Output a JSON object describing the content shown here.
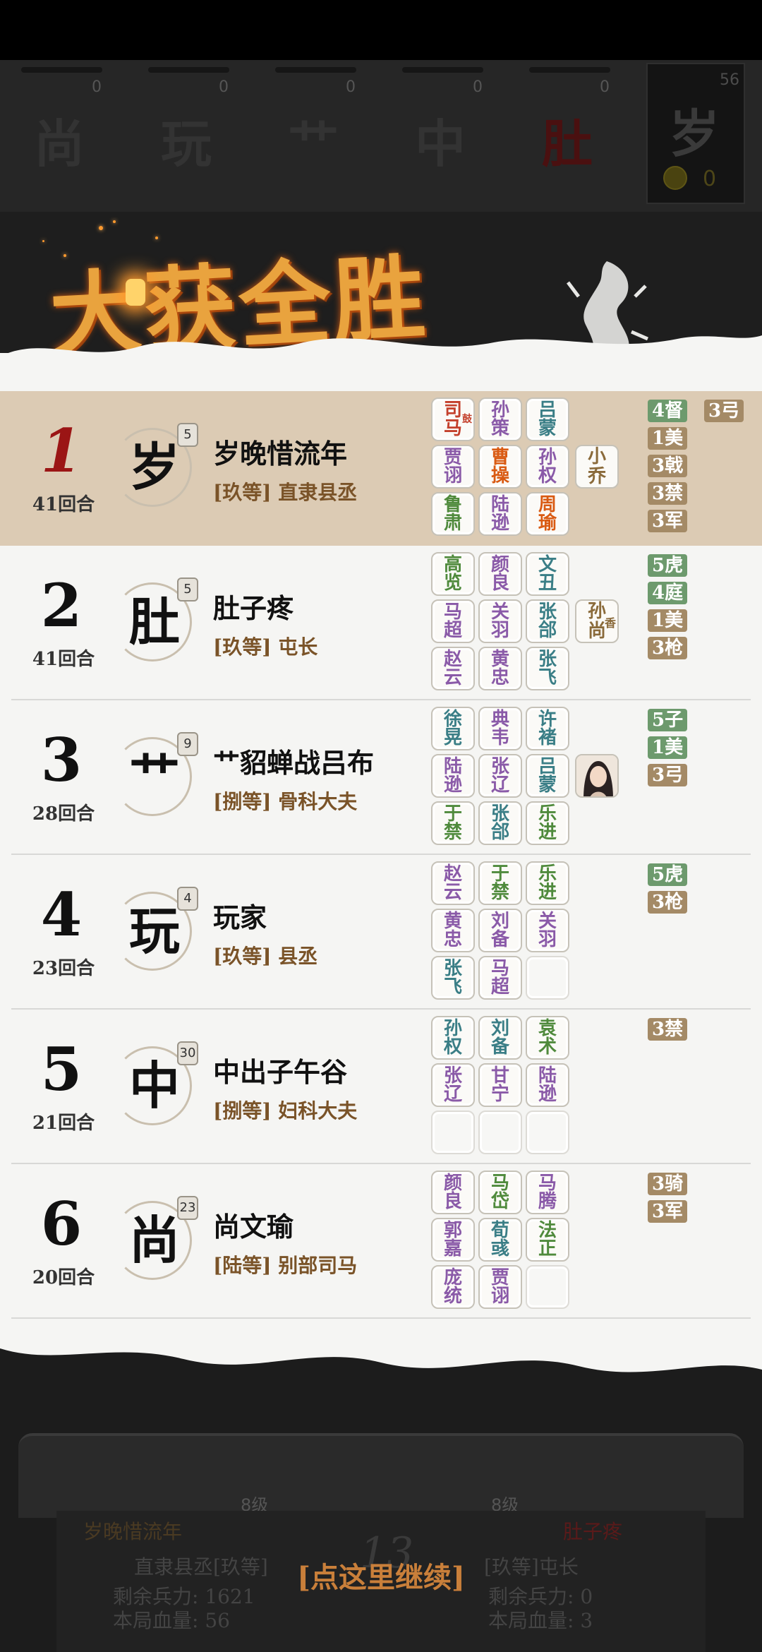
{
  "players_bar": [
    {
      "char": "尚",
      "count": "0"
    },
    {
      "char": "玩",
      "count": "0"
    },
    {
      "char": "艹",
      "count": "0"
    },
    {
      "char": "中",
      "count": "0"
    },
    {
      "char": "肚",
      "count": "0"
    }
  ],
  "players_bar_active": {
    "char": "岁",
    "count": "56",
    "coins": "0"
  },
  "banner": {
    "title": "大获全胜"
  },
  "rows": [
    {
      "rank": "1",
      "rounds": "41回合",
      "avatar_char": "岁",
      "level": "5",
      "name": "岁晚惜流年",
      "title": "[玖等] 直隶县丞",
      "heroes": [
        [
          "司",
          "马"
        ],
        [
          "孙",
          "策"
        ],
        [
          "吕",
          "蒙"
        ],
        [
          "贾",
          "诩"
        ],
        [
          "曹",
          "操"
        ],
        [
          "孙",
          "权"
        ],
        [
          "鲁",
          "肃"
        ],
        [
          "陆",
          "逊"
        ],
        [
          "周",
          "瑜"
        ]
      ],
      "hero_colors": [
        "c-red",
        "c-purple",
        "c-teal",
        "c-purple",
        "c-orange",
        "c-purple",
        "c-green",
        "c-purple",
        "c-orange"
      ],
      "hero_badge": "鼓",
      "extra": [
        "小",
        "乔"
      ],
      "tags": [
        "4督",
        "3弓",
        "1美",
        "3戟",
        "3禁",
        "3军"
      ]
    },
    {
      "rank": "2",
      "rounds": "41回合",
      "avatar_char": "肚",
      "level": "5",
      "name": "肚子疼",
      "title": "[玖等] 屯长",
      "heroes": [
        [
          "高",
          "览"
        ],
        [
          "颜",
          "良"
        ],
        [
          "文",
          "丑"
        ],
        [
          "马",
          "超"
        ],
        [
          "关",
          "羽"
        ],
        [
          "张",
          "郃"
        ],
        [
          "赵",
          "云"
        ],
        [
          "黄",
          "忠"
        ],
        [
          "张",
          "飞"
        ]
      ],
      "hero_colors": [
        "c-green",
        "c-purple",
        "c-teal",
        "c-purple",
        "c-purple",
        "c-teal",
        "c-purple",
        "c-purple",
        "c-teal"
      ],
      "extra": [
        "孙",
        "尚"
      ],
      "extra_badge": "香",
      "tags": [
        "5虎",
        "4庭",
        "1美",
        "3枪"
      ]
    },
    {
      "rank": "3",
      "rounds": "28回合",
      "avatar_char": "艹",
      "level": "9",
      "name": "艹貂蝉战吕布",
      "title": "[捌等] 骨科大夫",
      "heroes": [
        [
          "徐",
          "晃"
        ],
        [
          "典",
          "韦"
        ],
        [
          "许",
          "褚"
        ],
        [
          "陆",
          "逊"
        ],
        [
          "张",
          "辽"
        ],
        [
          "吕",
          "蒙"
        ],
        [
          "于",
          "禁"
        ],
        [
          "张",
          "郃"
        ],
        [
          "乐",
          "进"
        ]
      ],
      "hero_colors": [
        "c-teal",
        "c-purple",
        "c-teal",
        "c-purple",
        "c-purple",
        "c-teal",
        "c-green",
        "c-teal",
        "c-green"
      ],
      "tags": [
        "5子",
        "1美",
        "3弓"
      ]
    },
    {
      "rank": "4",
      "rounds": "23回合",
      "avatar_char": "玩",
      "level": "4",
      "name": "玩家",
      "title": "[玖等] 县丞",
      "heroes": [
        [
          "赵",
          "云"
        ],
        [
          "于",
          "禁"
        ],
        [
          "乐",
          "进"
        ],
        [
          "黄",
          "忠"
        ],
        [
          "刘",
          "备"
        ],
        [
          "关",
          "羽"
        ],
        [
          "张",
          "飞"
        ],
        [
          "马",
          "超"
        ],
        [
          "",
          ""
        ]
      ],
      "hero_colors": [
        "c-purple",
        "c-green",
        "c-green",
        "c-purple",
        "c-purple",
        "c-purple",
        "c-teal",
        "c-purple",
        ""
      ],
      "tags": [
        "5虎",
        "3枪"
      ]
    },
    {
      "rank": "5",
      "rounds": "21回合",
      "avatar_char": "中",
      "level": "30",
      "name": "中出子午谷",
      "title": "[捌等] 妇科大夫",
      "heroes": [
        [
          "孙",
          "权"
        ],
        [
          "刘",
          "备"
        ],
        [
          "袁",
          "术"
        ],
        [
          "张",
          "辽"
        ],
        [
          "甘",
          "宁"
        ],
        [
          "陆",
          "逊"
        ],
        [
          "",
          ""
        ],
        [
          "",
          ""
        ],
        [
          "",
          ""
        ]
      ],
      "hero_colors": [
        "c-teal",
        "c-teal",
        "c-green",
        "c-purple",
        "c-purple",
        "c-purple",
        "",
        "",
        ""
      ],
      "tags": [
        "3禁"
      ]
    },
    {
      "rank": "6",
      "rounds": "20回合",
      "avatar_char": "尚",
      "level": "23",
      "name": "尚文瑜",
      "title": "[陆等] 别部司马",
      "heroes": [
        [
          "颜",
          "良"
        ],
        [
          "马",
          "岱"
        ],
        [
          "马",
          "腾"
        ],
        [
          "郭",
          "嘉"
        ],
        [
          "荀",
          "彧"
        ],
        [
          "法",
          "正"
        ],
        [
          "庞",
          "统"
        ],
        [
          "贾",
          "诩"
        ],
        [
          "",
          ""
        ]
      ],
      "hero_colors": [
        "c-purple",
        "c-green",
        "c-purple",
        "c-purple",
        "c-teal",
        "c-green",
        "c-purple",
        "c-purple",
        ""
      ],
      "tags": [
        "3骑",
        "3军"
      ]
    }
  ],
  "bottom": {
    "left_level": "8级",
    "right_level": "8级",
    "left_name": "岁晚惜流年",
    "left_title": "直隶县丞[玖等]",
    "left_troops": "剩余兵力:  1621",
    "left_hp": "本局血量:  56",
    "right_name": "肚子疼",
    "right_title": "[玖等]屯长",
    "right_troops": "剩余兵力:  0",
    "right_hp": "本局血量:  3",
    "center_number": "13",
    "continue_label": "[点这里继续]"
  },
  "colors": {
    "highlight_row": "#dccbb4",
    "tag_green": "#6d9a6d",
    "tag_brown": "#a48a66",
    "banner_orange": "#e9a33e",
    "continue_text": "#c97f3a"
  }
}
